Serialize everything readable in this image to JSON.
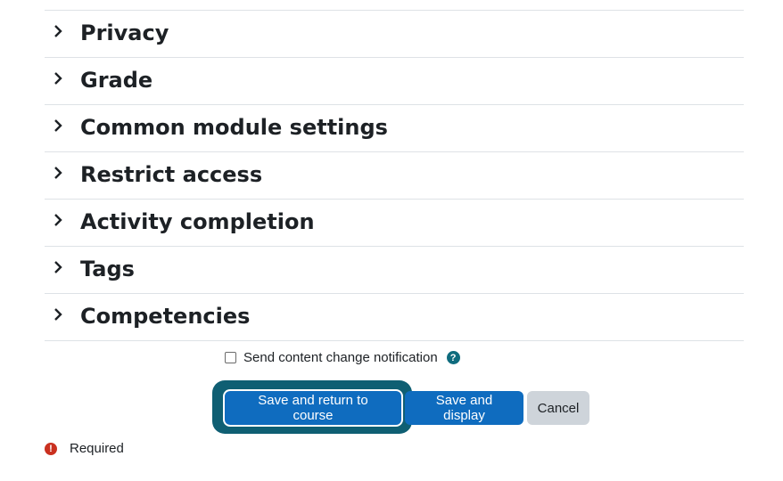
{
  "sections": [
    {
      "title": "Privacy"
    },
    {
      "title": "Grade"
    },
    {
      "title": "Common module settings"
    },
    {
      "title": "Restrict access"
    },
    {
      "title": "Activity completion"
    },
    {
      "title": "Tags"
    },
    {
      "title": "Competencies"
    }
  ],
  "notification": {
    "label": "Send content change notification",
    "checked": false,
    "help_icon": "?"
  },
  "buttons": {
    "save_return": "Save and return to course",
    "save_display": "Save and display",
    "cancel": "Cancel"
  },
  "required": {
    "icon": "!",
    "label": "Required"
  },
  "colors": {
    "primary": "#0f6cbf",
    "focus_ring": "#0f5f73",
    "danger": "#ca3120",
    "secondary": "#ced4da"
  }
}
